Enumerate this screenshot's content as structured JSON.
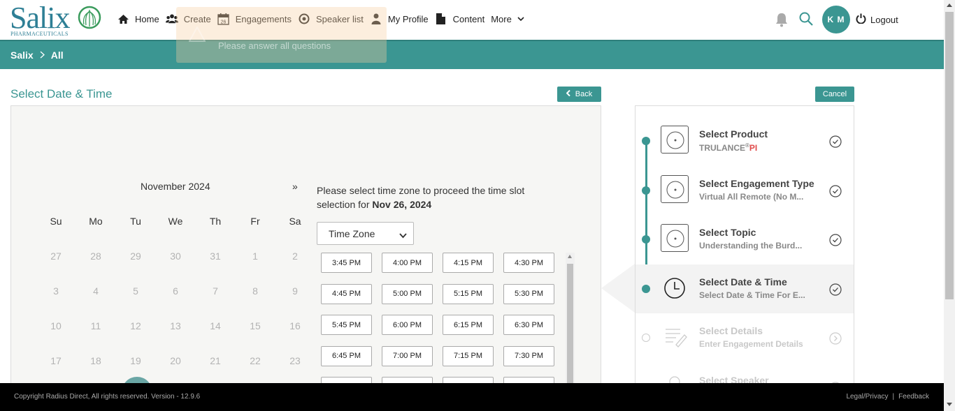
{
  "logo": {
    "name": "Salix",
    "sub": "PHARMACEUTICALS"
  },
  "nav": {
    "items": [
      {
        "label": "Home",
        "icon": "home-icon"
      },
      {
        "label": "Create",
        "icon": "users-icon"
      },
      {
        "label": "Engagements",
        "icon": "calendar-icon",
        "icon_text": "26"
      },
      {
        "label": "Speaker list",
        "icon": "target-icon"
      },
      {
        "label": "My Profile",
        "icon": "user-icon"
      },
      {
        "label": "Content",
        "icon": "document-icon"
      },
      {
        "label": "More",
        "icon": "chevron-down-icon"
      }
    ],
    "avatar_initials": "K M",
    "logout_label": "Logout"
  },
  "toast": {
    "message": "Please answer all questions"
  },
  "breadcrumb": {
    "root": "Salix",
    "current": "All"
  },
  "page": {
    "title": "Select Date & Time",
    "back_label": "Back",
    "cancel_label": "Cancel"
  },
  "calendar": {
    "month_label": "November 2024",
    "next_label": "»",
    "weekdays": [
      "Su",
      "Mo",
      "Tu",
      "We",
      "Th",
      "Fr",
      "Sa"
    ],
    "weeks": [
      [
        "27",
        "28",
        "29",
        "30",
        "31",
        "1",
        "2"
      ],
      [
        "3",
        "4",
        "5",
        "6",
        "7",
        "8",
        "9"
      ],
      [
        "10",
        "11",
        "12",
        "13",
        "14",
        "15",
        "16"
      ],
      [
        "17",
        "18",
        "19",
        "20",
        "21",
        "22",
        "23"
      ]
    ]
  },
  "timeslots": {
    "prompt": "Please select time zone to proceed the time slot selection for",
    "selected_date": "Nov 26, 2024",
    "timezone_value": "Time Zone",
    "slots": [
      "3:45 PM",
      "4:00 PM",
      "4:15 PM",
      "4:30 PM",
      "4:45 PM",
      "5:00 PM",
      "5:15 PM",
      "5:30 PM",
      "5:45 PM",
      "6:00 PM",
      "6:15 PM",
      "6:30 PM",
      "6:45 PM",
      "7:00 PM",
      "7:15 PM",
      "7:30 PM",
      "",
      "",
      "",
      ""
    ]
  },
  "steps": [
    {
      "title": "Select Product",
      "sub": "TRULANCE",
      "sup": "®",
      "pi": "PI",
      "state": "done",
      "icon": "disc-icon"
    },
    {
      "title": "Select Engagement Type",
      "sub": "Virtual All Remote (No M...",
      "state": "done",
      "icon": "disc-icon"
    },
    {
      "title": "Select Topic",
      "sub": "Understanding the Burd...",
      "state": "done",
      "icon": "disc-icon"
    },
    {
      "title": "Select Date & Time",
      "sub": "Select Date & Time For E...",
      "state": "active",
      "icon": "clock-icon"
    },
    {
      "title": "Select Details",
      "sub": "Enter Engagement Details",
      "state": "disabled",
      "icon": "form-icon"
    },
    {
      "title": "Select Speaker",
      "sub": "",
      "state": "disabled",
      "icon": "person-icon"
    }
  ],
  "footer": {
    "copyright": "Copyright Radius Direct, All rights reserved. Version -  12.9.6",
    "legal_label": "Legal/Privacy",
    "separator": "|",
    "feedback_label": "Feedback"
  },
  "colors": {
    "teal": "#3b9692",
    "logo_blue": "#2e7f95",
    "footer": "#000000"
  }
}
